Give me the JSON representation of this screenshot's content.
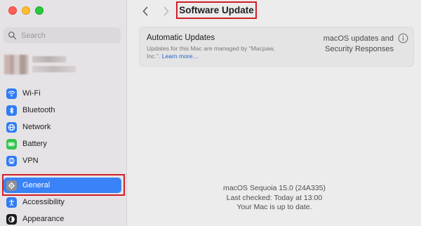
{
  "window": {
    "buttons": [
      "close",
      "minimize",
      "maximize"
    ]
  },
  "sidebar": {
    "search": {
      "placeholder": "Search",
      "value": ""
    },
    "items": [
      {
        "label": "Wi-Fi",
        "icon": "wifi-icon",
        "icon_color": "#2f7cf6"
      },
      {
        "label": "Bluetooth",
        "icon": "bluetooth-icon",
        "icon_color": "#2f7cf6"
      },
      {
        "label": "Network",
        "icon": "globe-icon",
        "icon_color": "#2f7cf6"
      },
      {
        "label": "Battery",
        "icon": "battery-icon",
        "icon_color": "#32c44c"
      },
      {
        "label": "VPN",
        "icon": "vpn-icon",
        "icon_color": "#2f7cf6"
      },
      {
        "label": "General",
        "icon": "gear-icon",
        "icon_color": "#8e8e93",
        "selected": true
      },
      {
        "label": "Accessibility",
        "icon": "accessibility-icon",
        "icon_color": "#2f7cf6"
      },
      {
        "label": "Appearance",
        "icon": "appearance-icon",
        "icon_color": "#1d1d1f"
      }
    ],
    "selection_color": "#3a82f7"
  },
  "toolbar": {
    "title": "Software Update"
  },
  "auto_updates": {
    "title": "Automatic Updates",
    "description": "Updates for this Mac are managed by \"Macpaw, Inc.\".",
    "link": "Learn more…",
    "value_line1": "macOS updates and",
    "value_line2": "Security Responses"
  },
  "status": {
    "version": "macOS Sequoia 15.0 (24A335)",
    "last_checked": "Last checked: Today at 13:00",
    "message": "Your Mac is up to date."
  },
  "annotation_color": "#d11f26"
}
